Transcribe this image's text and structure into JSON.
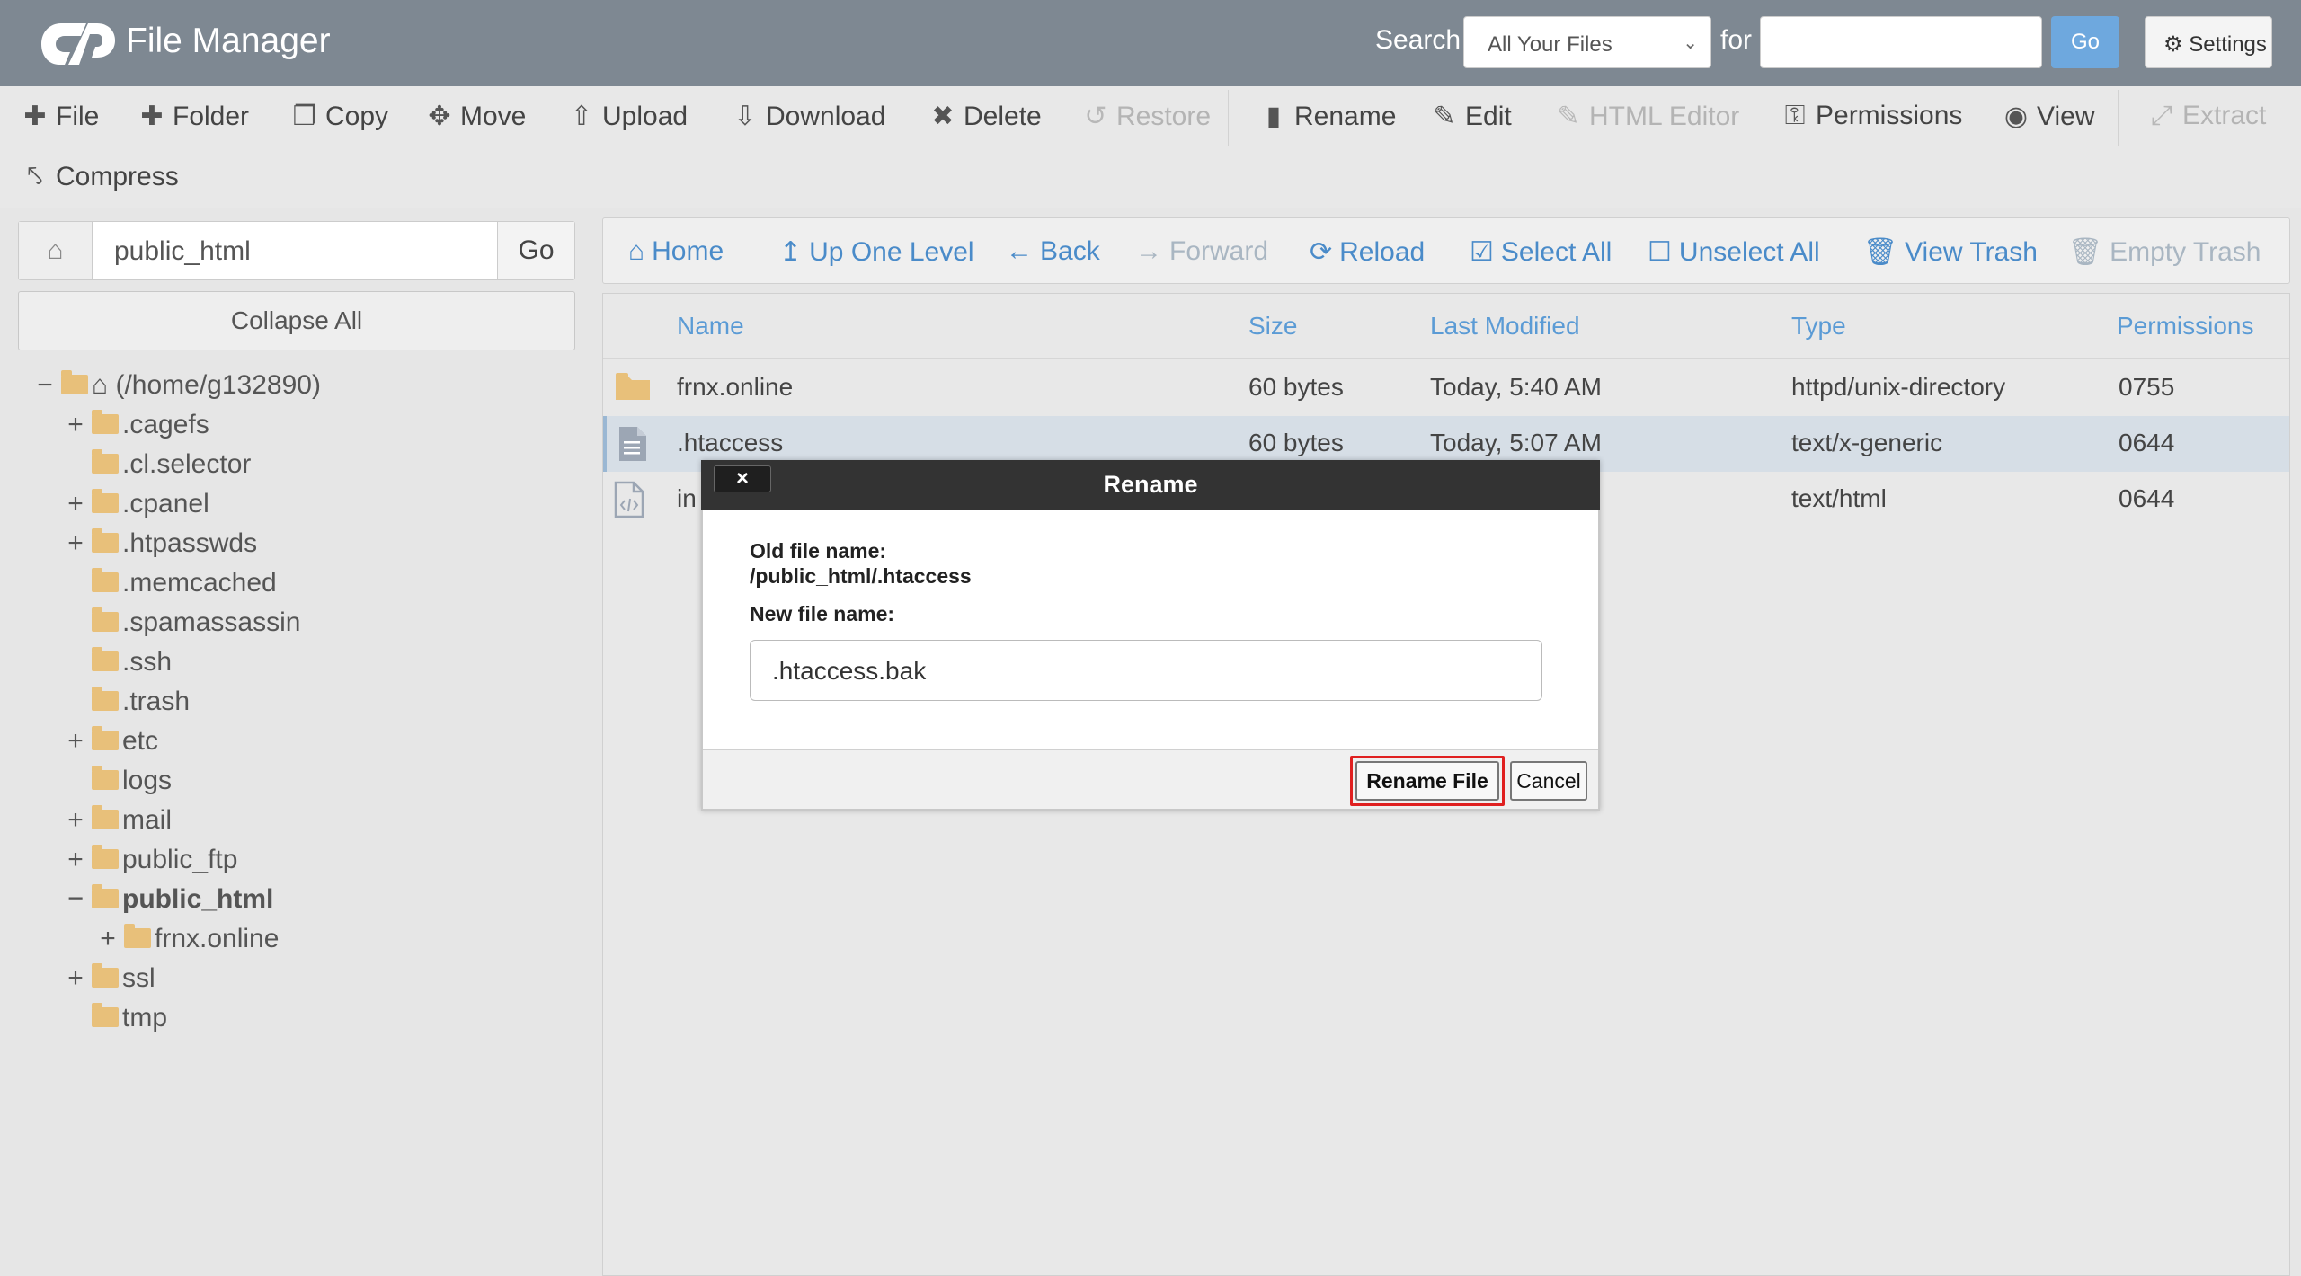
{
  "header": {
    "app_title": "File Manager",
    "search_label": "Search",
    "search_scope": "All Your Files",
    "for_label": "for",
    "search_value": "",
    "go_label": "Go",
    "settings_label": "Settings"
  },
  "toolbar": {
    "file": "File",
    "folder": "Folder",
    "copy": "Copy",
    "move": "Move",
    "upload": "Upload",
    "download": "Download",
    "delete": "Delete",
    "restore": "Restore",
    "rename": "Rename",
    "edit": "Edit",
    "html_editor": "HTML Editor",
    "permissions": "Permissions",
    "view": "View",
    "extract": "Extract",
    "compress": "Compress"
  },
  "path_bar": {
    "path": "public_html",
    "go_label": "Go"
  },
  "tree": {
    "collapse_all": "Collapse All",
    "root": "(/home/g132890)",
    "items": [
      {
        "label": ".cagefs",
        "toggle": "+"
      },
      {
        "label": ".cl.selector",
        "toggle": ""
      },
      {
        "label": ".cpanel",
        "toggle": "+"
      },
      {
        "label": ".htpasswds",
        "toggle": "+"
      },
      {
        "label": ".memcached",
        "toggle": ""
      },
      {
        "label": ".spamassassin",
        "toggle": ""
      },
      {
        "label": ".ssh",
        "toggle": ""
      },
      {
        "label": ".trash",
        "toggle": ""
      },
      {
        "label": "etc",
        "toggle": "+"
      },
      {
        "label": "logs",
        "toggle": ""
      },
      {
        "label": "mail",
        "toggle": "+"
      },
      {
        "label": "public_ftp",
        "toggle": "+"
      },
      {
        "label": "public_html",
        "toggle": "−"
      },
      {
        "label": "frnx.online",
        "toggle": "+"
      },
      {
        "label": "ssl",
        "toggle": "+"
      },
      {
        "label": "tmp",
        "toggle": ""
      }
    ]
  },
  "nav": {
    "home": "Home",
    "up_one_level": "Up One Level",
    "back": "Back",
    "forward": "Forward",
    "reload": "Reload",
    "select_all": "Select All",
    "unselect_all": "Unselect All",
    "view_trash": "View Trash",
    "empty_trash": "Empty Trash"
  },
  "columns": {
    "name": "Name",
    "size": "Size",
    "last_modified": "Last Modified",
    "type": "Type",
    "permissions": "Permissions"
  },
  "files": [
    {
      "name": "frnx.online",
      "size": "60 bytes",
      "modified": "Today, 5:40 AM",
      "type": "httpd/unix-directory",
      "perms": "0755"
    },
    {
      "name": ".htaccess",
      "size": "60 bytes",
      "modified": "Today, 5:07 AM",
      "type": "text/x-generic",
      "perms": "0644"
    },
    {
      "name": "in",
      "size": "",
      "modified": "",
      "type": "text/html",
      "perms": "0644"
    }
  ],
  "dialog": {
    "title": "Rename",
    "close": "×",
    "old_label": "Old file name:",
    "old_value": "/public_html/.htaccess",
    "new_label": "New file name:",
    "new_value": ".htaccess.bak",
    "rename_button": "Rename File",
    "cancel_button": "Cancel"
  },
  "colors": {
    "header_bg": "#7e8892",
    "link_blue": "#4a8bc9",
    "highlight_red": "#e02020",
    "folder": "#e8c07a"
  }
}
